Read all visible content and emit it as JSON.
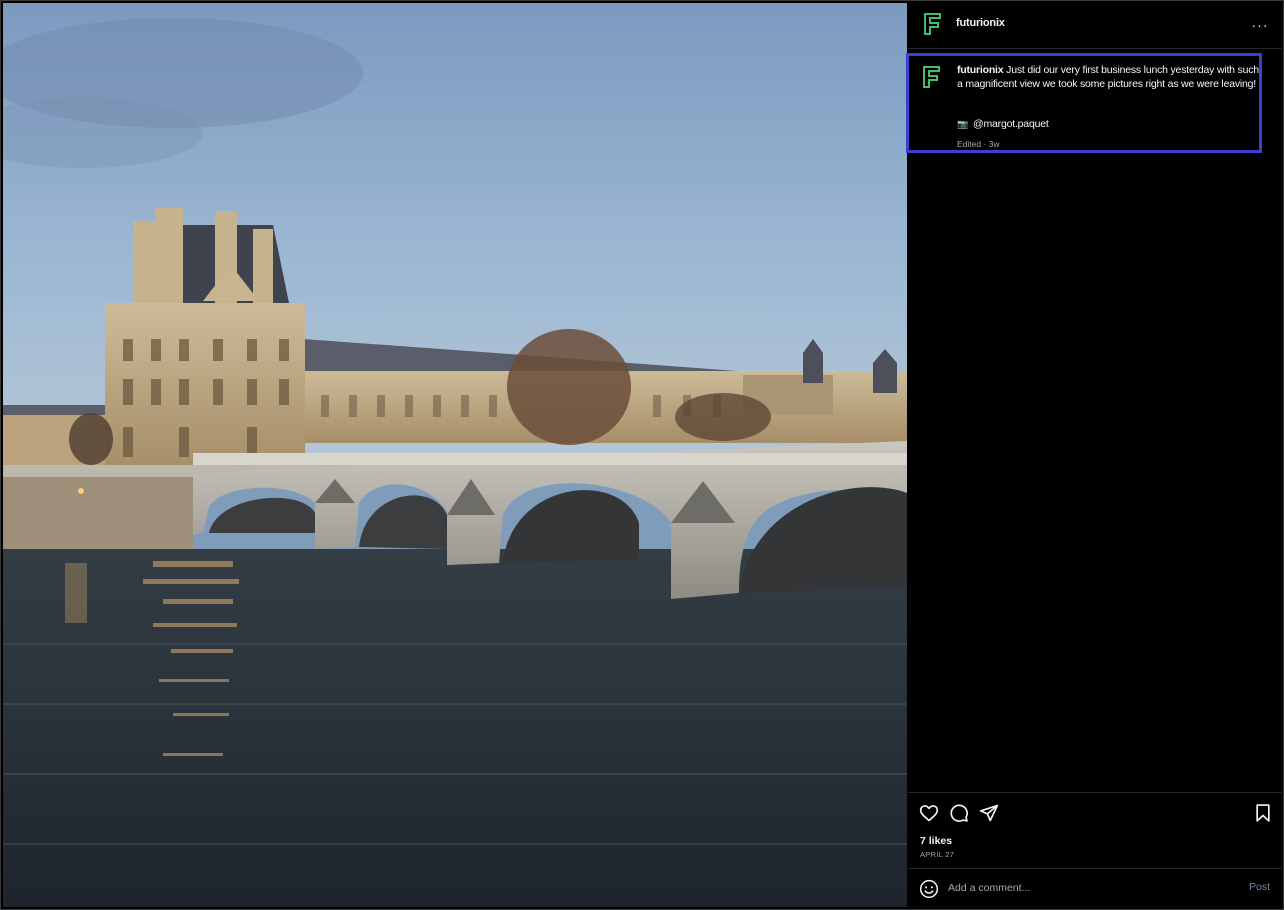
{
  "post": {
    "username": "futurionix",
    "caption_username": "futurionix",
    "caption": "Just did our very first business lunch yesterday with such a magnificent view we took some pictures right as we were leaving!",
    "credit_handle": "@margot.paquet",
    "meta": "Edited · 3w",
    "likes": "7 likes",
    "date": "APRIL 27",
    "more_label": "···"
  },
  "comment": {
    "placeholder": "Add a comment...",
    "post_label": "Post"
  },
  "icons": {
    "avatar": "futurionix-logo-icon",
    "camera": "camera-icon",
    "like": "heart-icon",
    "comment": "comment-icon",
    "share": "send-icon",
    "save": "bookmark-icon",
    "emoji": "smiley-icon"
  },
  "colors": {
    "background": "#000000",
    "text": "#f5f5f5",
    "muted": "#a8a8a8",
    "highlight_border": "#3c3fcf",
    "post_button": "#7a8aa8",
    "logo_green": "#3fbf6a"
  }
}
